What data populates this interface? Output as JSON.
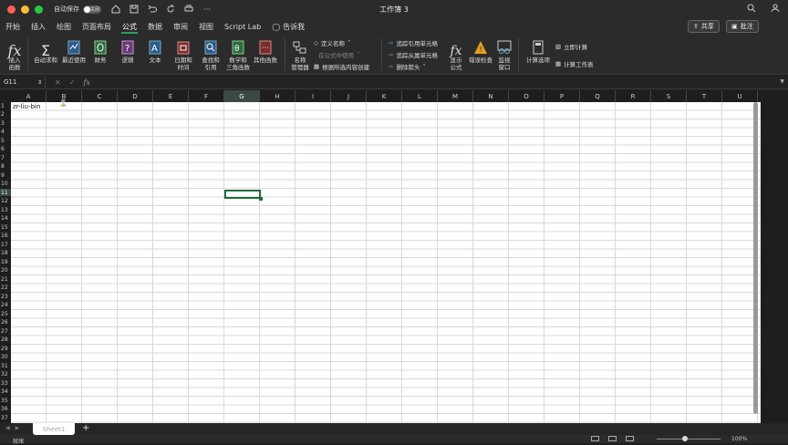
{
  "window": {
    "title": "工作簿 3",
    "autosave_label": "自动保存",
    "autosave_state": "关闭"
  },
  "menu": {
    "tabs": [
      "开始",
      "插入",
      "绘图",
      "页面布局",
      "公式",
      "数据",
      "审阅",
      "视图",
      "Script Lab",
      "告诉我"
    ],
    "active_tab": "公式",
    "share_label": "共享",
    "comments_label": "批注"
  },
  "ribbon": {
    "insert_function": "插入\n函数",
    "autosum": "自动求和",
    "recent": "最近使用",
    "financial": "财务",
    "logical": "逻辑",
    "text": "文本",
    "datetime": "日期和\n时间",
    "lookup": "查找和\n引用",
    "math": "数学和\n三角函数",
    "more": "其他函数",
    "name_manager": "名称\n管理器",
    "define_name": "定义名称",
    "use_in_formula": "在公式中使用",
    "create_from_selection": "根据所选内容创建",
    "trace_precedents": "追踪引用单元格",
    "trace_dependents": "追踪从属单元格",
    "remove_arrows": "删除箭头",
    "show_formulas": "显示\n公式",
    "error_checking": "错误检查",
    "watch_window": "监视\n窗口",
    "calc_options": "计算选项",
    "calc_now": "立即计算",
    "calc_sheet": "计算工作表"
  },
  "formula_bar": {
    "name_box": "G11",
    "fx": "fx",
    "content": ""
  },
  "grid": {
    "columns": [
      "A",
      "B",
      "C",
      "D",
      "E",
      "F",
      "G",
      "H",
      "I",
      "J",
      "K",
      "L",
      "M",
      "N",
      "O",
      "P",
      "Q",
      "R",
      "S",
      "T",
      "U"
    ],
    "selected_column": "G",
    "rows": [
      "1",
      "2",
      "3",
      "4",
      "5",
      "6",
      "7",
      "8",
      "9",
      "10",
      "11",
      "12",
      "13",
      "14",
      "15",
      "16",
      "17",
      "18",
      "19",
      "20",
      "21",
      "22",
      "23",
      "24",
      "25",
      "26",
      "27",
      "28",
      "29",
      "30",
      "31",
      "32",
      "33",
      "34",
      "35",
      "36",
      "37"
    ],
    "selected_row": "11",
    "cell_A1": "zr-liu-bin"
  },
  "sheets": {
    "tabs": [
      "Sheet1"
    ],
    "add_label": "+"
  },
  "status": {
    "ready": "就绪",
    "zoom": "100%"
  },
  "colors": {
    "accent": "#1e6b3a",
    "tab_underline": "#2f9e5a",
    "background": "#2b2b2b"
  }
}
